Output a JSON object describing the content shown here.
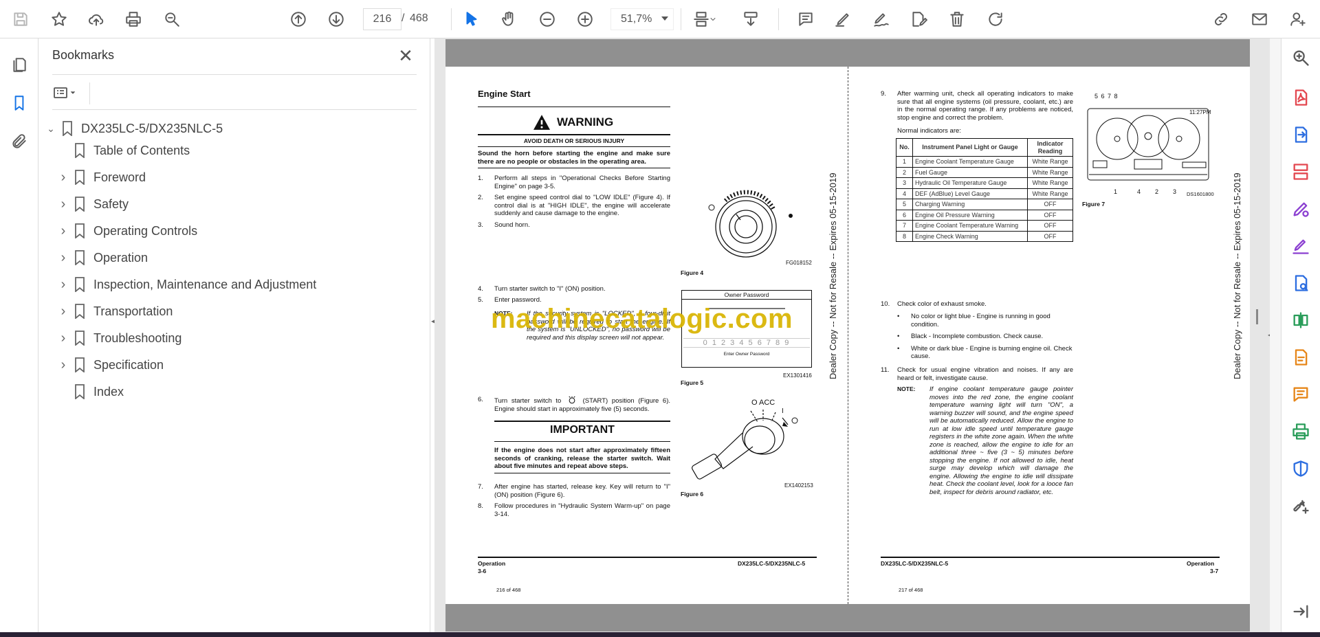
{
  "toolbar": {
    "current_page": "216",
    "page_separator": "/",
    "total_pages": "468",
    "zoom": "51,7%"
  },
  "bookmarks_panel": {
    "title": "Bookmarks",
    "close": "✕",
    "root": "DX235LC-5/DX235NLC-5",
    "items": [
      {
        "label": "Table of Contents",
        "expandable": false
      },
      {
        "label": "Foreword",
        "expandable": true
      },
      {
        "label": "Safety",
        "expandable": true
      },
      {
        "label": "Operating Controls",
        "expandable": true
      },
      {
        "label": "Operation",
        "expandable": true
      },
      {
        "label": "Inspection, Maintenance and Adjustment",
        "expandable": true
      },
      {
        "label": "Transportation",
        "expandable": true
      },
      {
        "label": "Troubleshooting",
        "expandable": true
      },
      {
        "label": "Specification",
        "expandable": true
      },
      {
        "label": "Index",
        "expandable": false
      }
    ]
  },
  "doc": {
    "left": {
      "heading": "Engine Start",
      "warning_title": "WARNING",
      "warning_sub": "AVOID DEATH OR SERIOUS INJURY",
      "warning_text": "Sound the horn before starting the engine and make sure there are no people or obstacles in the operating area.",
      "steps_a": [
        {
          "n": "1.",
          "t": "Perform all steps in \"Operational Checks Before Starting Engine\" on page 3-5."
        },
        {
          "n": "2.",
          "t": "Set engine speed control dial to \"LOW IDLE\" (Figure 4). If control dial is at \"HIGH IDLE\", the engine will accelerate suddenly and cause damage to the engine."
        },
        {
          "n": "3.",
          "t": "Sound horn."
        }
      ],
      "steps_b": [
        {
          "n": "4.",
          "t": "Turn starter switch to \"I\" (ON) position."
        },
        {
          "n": "5.",
          "t": "Enter password."
        }
      ],
      "note_label": "NOTE:",
      "note_text": "If the security system is \"LOCKED\", a four-digit password will be required to start the engine. If the system is \"UNLOCKED\", no password will be required and this display screen will not appear.",
      "step6": {
        "n": "6.",
        "t1": "Turn starter switch to",
        "t2": "(START) position (Figure 6). Engine should start in approximately five (5) seconds."
      },
      "important_title": "IMPORTANT",
      "important_text": "If the engine does not start after approximately fifteen seconds of cranking, release the starter switch. Wait about five minutes and repeat above steps.",
      "steps_c": [
        {
          "n": "7.",
          "t": "After engine has started, release key. Key will return to \"I\" (ON) position (Figure 6)."
        },
        {
          "n": "8.",
          "t": "Follow procedures in \"Hydraulic System Warm-up\" on page 3-14."
        }
      ],
      "fig4_code": "FG018152",
      "fig4_caption": "Figure 4",
      "fig5_header": "Owner Password",
      "fig5_digits": "0 1 2 3 4 5 6 7 8 9",
      "fig5_footer": "Enter Owner Password",
      "fig5_code": "EX1301416",
      "fig5_caption": "Figure 5",
      "fig6_labels": "O  ACC",
      "fig6_i": "I",
      "fig6_code": "EX1402153",
      "fig6_caption": "Figure 6",
      "footer_section": "Operation",
      "footer_page": "3-6",
      "footer_model": "DX235LC-5/DX235NLC-5",
      "page_of": "216 of 468",
      "side_watermark": "Dealer Copy -- Not for Resale -- Expires 05-15-2019"
    },
    "right": {
      "step9": {
        "n": "9.",
        "t": "After warming unit, check all operating indicators to make sure that all engine systems (oil pressure, coolant, etc.) are in the normal operating range. If any problems are noticed, stop engine and correct the problem."
      },
      "normal_label": "Normal indicators are:",
      "table_headers": [
        "No.",
        "Instrument Panel Light or Gauge",
        "Indicator Reading"
      ],
      "table_rows": [
        [
          "1",
          "Engine Coolant Temperature Gauge",
          "White Range"
        ],
        [
          "2",
          "Fuel Gauge",
          "White Range"
        ],
        [
          "3",
          "Hydraulic Oil Temperature Gauge",
          "White Range"
        ],
        [
          "4",
          "DEF (AdBlue) Level Gauge",
          "White Range"
        ],
        [
          "5",
          "Charging Warning",
          "OFF"
        ],
        [
          "6",
          "Engine Oil Pressure Warning",
          "OFF"
        ],
        [
          "7",
          "Engine Coolant Temperature Warning",
          "OFF"
        ],
        [
          "8",
          "Engine Check Warning",
          "OFF"
        ]
      ],
      "step10": {
        "n": "10.",
        "t": "Check color of exhaust smoke."
      },
      "bullets": [
        "No color or light blue - Engine is running in good condition.",
        "Black - Incomplete combustion. Check cause.",
        "White or dark blue - Engine is burning engine oil. Check cause."
      ],
      "step11": {
        "n": "11.",
        "t": "Check for usual engine vibration and noises. If any are heard or felt, investigate cause."
      },
      "note_label": "NOTE:",
      "note_text": "If engine coolant temperature gauge pointer moves into the red zone, the engine coolant temperature warning light will turn \"ON\", a warning buzzer will sound, and the engine speed will be automatically reduced. Allow the engine to run at low idle speed until temperature gauge registers in the white zone again. When the white zone is reached, allow the engine to idle for an additional three ~ five (3 ~ 5) minutes before stopping the engine. If not allowed to idle, heat surge may develop which will damage the engine. Allowing the engine to idle will dissipate heat. Check the coolant level, look for a looce fan belt, inspect for debris around radiator, etc.",
      "fig7_top_labels": "5  6  7  8",
      "fig7_bottom_labels": [
        "1",
        "4",
        "2",
        "3"
      ],
      "fig7_time": "11:27PM",
      "fig7_code": "DS1601800",
      "fig7_caption": "Figure 7",
      "footer_section": "Operation",
      "footer_page": "3-7",
      "footer_model": "DX235LC-5/DX235NLC-5",
      "page_of": "217 of 468",
      "side_watermark": "Dealer Copy -- Not for Resale -- Expires 05-15-2019"
    },
    "overlay_watermark": "machinecatalogic.com"
  },
  "colors": {
    "accent_blue": "#1473e6",
    "rail_purple": "#8b3fd1",
    "rail_red": "#e34850",
    "rail_blue": "#2d6ee0",
    "rail_green": "#2a9d5a",
    "rail_orange": "#e68619",
    "watermark_gold": "#d8b400"
  }
}
